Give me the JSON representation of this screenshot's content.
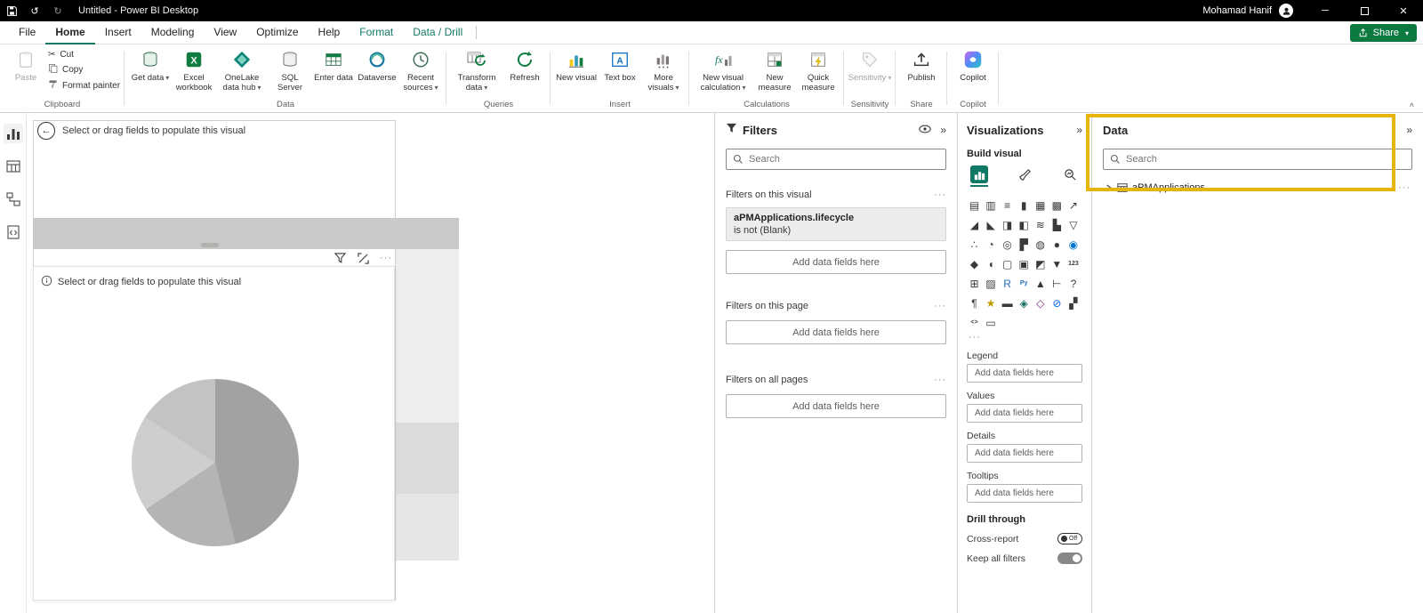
{
  "app": {
    "accent": "#117865",
    "highlight": "#e8b408",
    "share_green": "#0c7a40"
  },
  "titlebar": {
    "title": "Untitled - Power BI Desktop",
    "user": "Mohamad Hanif"
  },
  "menubar": {
    "tabs": [
      {
        "label": "File"
      },
      {
        "label": "Home",
        "active": true
      },
      {
        "label": "Insert"
      },
      {
        "label": "Modeling"
      },
      {
        "label": "View"
      },
      {
        "label": "Optimize"
      },
      {
        "label": "Help"
      },
      {
        "label": "Format",
        "contextual": true
      },
      {
        "label": "Data / Drill",
        "contextual": true
      }
    ],
    "share_label": "Share"
  },
  "ribbon": {
    "clipboard": {
      "label": "Clipboard",
      "paste": "Paste",
      "cut": "Cut",
      "copy": "Copy",
      "format_painter": "Format painter"
    },
    "data": {
      "label": "Data",
      "get_data": "Get data",
      "excel_workbook": "Excel workbook",
      "onelake": "OneLake data hub",
      "sql_server": "SQL Server",
      "enter_data": "Enter data",
      "dataverse": "Dataverse",
      "recent_sources": "Recent sources"
    },
    "queries": {
      "label": "Queries",
      "transform_data": "Transform data",
      "refresh": "Refresh"
    },
    "insert_group": {
      "label": "Insert",
      "new_visual": "New visual",
      "text_box": "Text box",
      "more_visuals": "More visuals"
    },
    "calculations": {
      "label": "Calculations",
      "new_visual_calculation": "New visual calculation",
      "new_measure": "New measure",
      "quick_measure": "Quick measure"
    },
    "sensitivity": {
      "label": "Sensitivity",
      "button": "Sensitivity"
    },
    "share": {
      "label": "Share",
      "publish": "Publish"
    },
    "copilot": {
      "label": "Copilot",
      "button": "Copilot"
    }
  },
  "canvas": {
    "visual_placeholder": "Select or drag fields to populate this visual",
    "card_placeholder": "Select or drag fields to populate this visual",
    "pie": {
      "segments": [
        {
          "color": "#a2a2a2",
          "from": 0,
          "to": 166
        },
        {
          "color": "#b4b4b4",
          "from": 166,
          "to": 236
        },
        {
          "color": "#cecece",
          "from": 236,
          "to": 303
        },
        {
          "color": "#c3c3c3",
          "from": 303,
          "to": 360
        }
      ]
    }
  },
  "filters": {
    "title": "Filters",
    "search_placeholder": "Search",
    "visual_section": {
      "label": "Filters on this visual",
      "card_field": "aPMApplications.lifecycle",
      "card_condition": "is not (Blank)",
      "add_placeholder": "Add data fields here"
    },
    "page_section": {
      "label": "Filters on this page",
      "add_placeholder": "Add data fields here"
    },
    "all_section": {
      "label": "Filters on all pages",
      "add_placeholder": "Add data fields here"
    }
  },
  "visualizations": {
    "title": "Visualizations",
    "build_label": "Build visual",
    "gallery": [
      {
        "name": "stacked-bar-chart",
        "glyph": "▤"
      },
      {
        "name": "stacked-column-chart",
        "glyph": "▥"
      },
      {
        "name": "clustered-bar-chart",
        "glyph": "≡"
      },
      {
        "name": "clustered-column-chart",
        "glyph": "▮"
      },
      {
        "name": "100-stacked-bar-chart",
        "glyph": "▦"
      },
      {
        "name": "100-stacked-column-chart",
        "glyph": "▩"
      },
      {
        "name": "line-chart",
        "glyph": "↗"
      },
      {
        "name": "area-chart",
        "glyph": "◢"
      },
      {
        "name": "stacked-area-chart",
        "glyph": "◣"
      },
      {
        "name": "line-and-stacked-column-chart",
        "glyph": "◨"
      },
      {
        "name": "line-and-clustered-column-chart",
        "glyph": "◧"
      },
      {
        "name": "ribbon-chart",
        "glyph": "≋"
      },
      {
        "name": "waterfall-chart",
        "glyph": "▙"
      },
      {
        "name": "funnel-chart",
        "glyph": "▽"
      },
      {
        "name": "scatter-chart",
        "glyph": "∴"
      },
      {
        "name": "pie-chart",
        "glyph": "◔"
      },
      {
        "name": "donut-chart",
        "glyph": "◎"
      },
      {
        "name": "treemap",
        "glyph": "▛"
      },
      {
        "name": "map",
        "glyph": "◍"
      },
      {
        "name": "filled-map",
        "glyph": "●"
      },
      {
        "name": "azure-map",
        "glyph": "◉",
        "color": "#0078d4"
      },
      {
        "name": "shape-map",
        "glyph": "◆"
      },
      {
        "name": "gauge",
        "glyph": "◖"
      },
      {
        "name": "card",
        "glyph": "▢"
      },
      {
        "name": "multi-row-card",
        "glyph": "▣"
      },
      {
        "name": "kpi",
        "glyph": "◩"
      },
      {
        "name": "slicer",
        "glyph": "▼"
      },
      {
        "name": "numeric-card",
        "glyph": "123",
        "small": true
      },
      {
        "name": "table",
        "glyph": "⊞"
      },
      {
        "name": "matrix",
        "glyph": "▨"
      },
      {
        "name": "r-script-visual",
        "glyph": "R",
        "color": "#276fbf"
      },
      {
        "name": "python-visual",
        "glyph": "Py",
        "color": "#276fbf",
        "small": true
      },
      {
        "name": "key-influencers",
        "glyph": "▲"
      },
      {
        "name": "decomposition-tree",
        "glyph": "⊢"
      },
      {
        "name": "qa-visual",
        "glyph": "?"
      },
      {
        "name": "smart-narrative",
        "glyph": "¶"
      },
      {
        "name": "metrics",
        "glyph": "★",
        "color": "#c19c00"
      },
      {
        "name": "paginated-report",
        "glyph": "▬"
      },
      {
        "name": "arcgis-map",
        "glyph": "◈",
        "color": "#0c695a"
      },
      {
        "name": "power-apps",
        "glyph": "◇",
        "color": "#742774"
      },
      {
        "name": "power-automate",
        "glyph": "⊘",
        "color": "#0066ff"
      },
      {
        "name": "scroller",
        "glyph": "▞"
      },
      {
        "name": "html-viewer",
        "glyph": "<>",
        "small": true
      },
      {
        "name": "advanced-card",
        "glyph": "▭"
      }
    ],
    "gallery_more": "···",
    "wells": [
      {
        "label": "Legend",
        "placeholder": "Add data fields here"
      },
      {
        "label": "Values",
        "placeholder": "Add data fields here"
      },
      {
        "label": "Details",
        "placeholder": "Add data fields here"
      },
      {
        "label": "Tooltips",
        "placeholder": "Add data fields here"
      }
    ],
    "drill": {
      "title": "Drill through",
      "cross_report": "Cross-report",
      "cross_report_state": "Off",
      "keep_filters": "Keep all filters"
    }
  },
  "data_pane": {
    "title": "Data",
    "search_placeholder": "Search",
    "tables": [
      {
        "name": "aPMApplications"
      }
    ]
  }
}
